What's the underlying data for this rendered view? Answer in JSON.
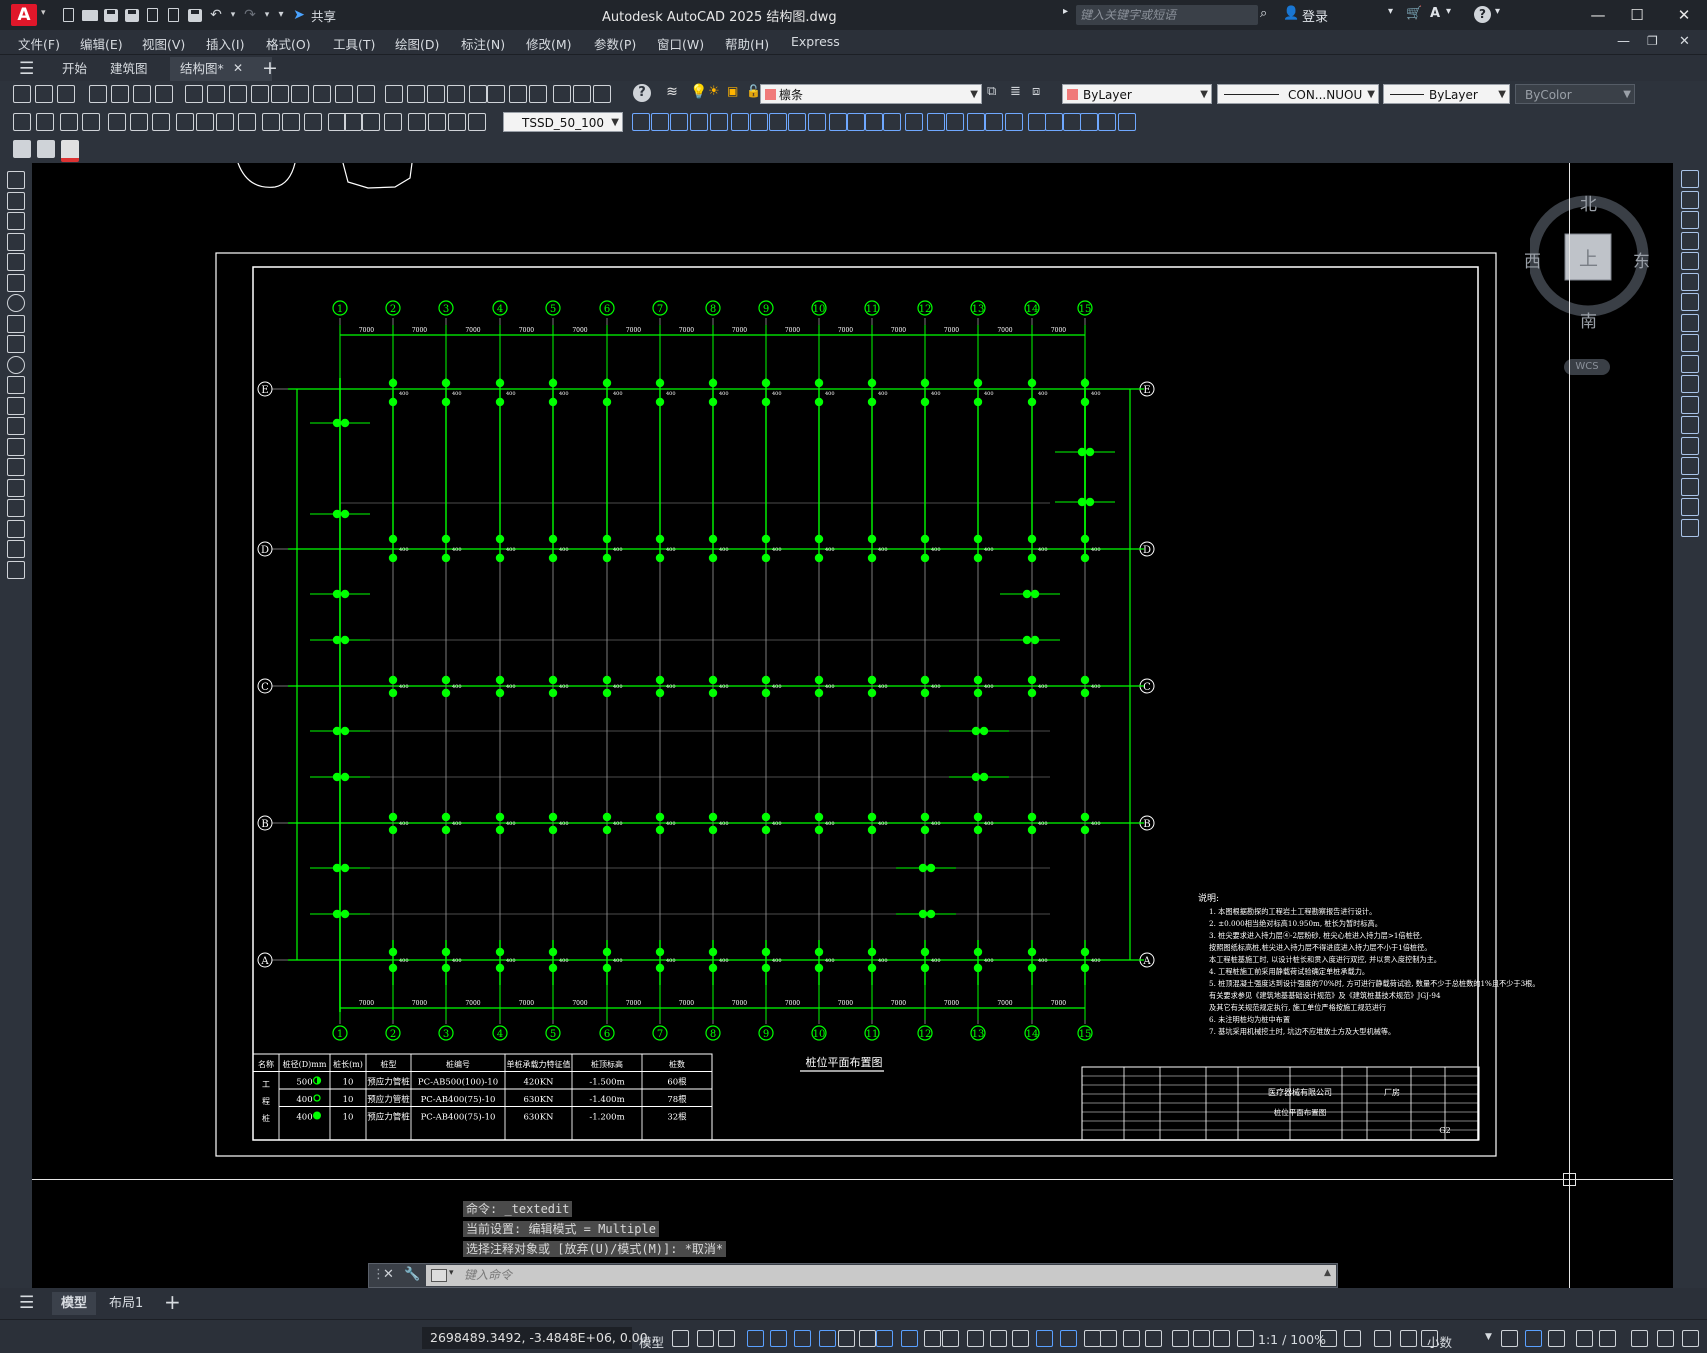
{
  "app": {
    "logo": "A",
    "title": "Autodesk AutoCAD 2025    结构图.dwg",
    "share": "共享",
    "search_placeholder": "键入关键字或短语",
    "login": "登录"
  },
  "menu": [
    "文件(F)",
    "编辑(E)",
    "视图(V)",
    "插入(I)",
    "格式(O)",
    "工具(T)",
    "绘图(D)",
    "标注(N)",
    "修改(M)",
    "参数(P)",
    "窗口(W)",
    "帮助(H)",
    "Express"
  ],
  "tabs": [
    "开始",
    "建筑图",
    "结构图*"
  ],
  "toolbar": {
    "layer": "檩条",
    "color": "ByLayer",
    "linetype": "CON...NUOU",
    "lineweight": "ByLayer",
    "plotstyle": "ByColor",
    "dimstyle": "TSSD_50_100"
  },
  "viewcube": {
    "north": "北",
    "south": "南",
    "east": "东",
    "west": "西",
    "face": "上",
    "wcs": "WCS"
  },
  "drawing": {
    "columns": [
      "1",
      "2",
      "3",
      "4",
      "5",
      "6",
      "7",
      "8",
      "9",
      "10",
      "11",
      "12",
      "13",
      "14",
      "15"
    ],
    "rows": [
      "E",
      "D",
      "C",
      "B",
      "A"
    ],
    "plan_title": "桩位平面布置图",
    "notes_title": "说明:",
    "notes": [
      "1. 本图根据勘探的工程岩土工程勘察报告进行设计。",
      "2. ±0.000相当绝对标高10.950m, 桩长为暂时标高。",
      "3. 桩尖要求进入持力层④-2层粉砂, 桩尖心桩进入持力层>1倍桩径,",
      "   按照图纸标高桩,桩尖进入持力层不得进底进入持力层不小于1倍桩径。",
      "   本工程桩基施工时, 以设计桩长和贯入度进行双控, 并以贯入度控制为主。",
      "4. 工程桩施工前采用静载荷试验确定单桩承载力。",
      "5. 桩顶混凝土强度达到设计强度的70%时, 方可进行静载荷试验, 数量不少于总桩数的1%且不少于3根。",
      "   有关要求参见《建筑地基基础设计规范》及《建筑桩基技术规范》JGJ-94",
      "   及其它有关规范规定执行, 施工单位严格按施工规范进行",
      "6. 未注明桩均为桩中布置",
      "7. 基坑采用机械挖土时, 坑边不应堆放土方及大型机械等。"
    ],
    "pile_table": {
      "headers": [
        "名称",
        "桩径(D)mm",
        "桩长(m)",
        "桩型",
        "桩编号",
        "单桩承载力特征值",
        "桩顶标高",
        "桩数"
      ],
      "group": "工程桩",
      "rows": [
        [
          "500",
          "10",
          "预应力管桩",
          "PC-AB500(100)-10",
          "420KN",
          "-1.500m",
          "60根"
        ],
        [
          "400",
          "10",
          "预应力管桩",
          "PC-AB400(75)-10",
          "630KN",
          "-1.400m",
          "78根"
        ],
        [
          "400",
          "10",
          "预应力管桩",
          "PC-AB400(75)-10",
          "630KN",
          "-1.200m",
          "32根"
        ]
      ]
    },
    "title_block": {
      "company": "医疗器械有限公司",
      "building": "厂房",
      "drawing_name": "桩位平面布置图",
      "sheet": "G2"
    }
  },
  "command": {
    "history": [
      "命令: _textedit",
      "当前设置: 编辑模式 = Multiple",
      "选择注释对象或 [放弃(U)/模式(M)]: *取消*"
    ],
    "placeholder": "键入命令"
  },
  "layout_tabs": [
    "模型",
    "布局1"
  ],
  "status": {
    "coords": "2698489.3492, -3.4848E+06, 0.00...",
    "model": "模型",
    "scale": "1:1 / 100%",
    "units": "小数"
  }
}
